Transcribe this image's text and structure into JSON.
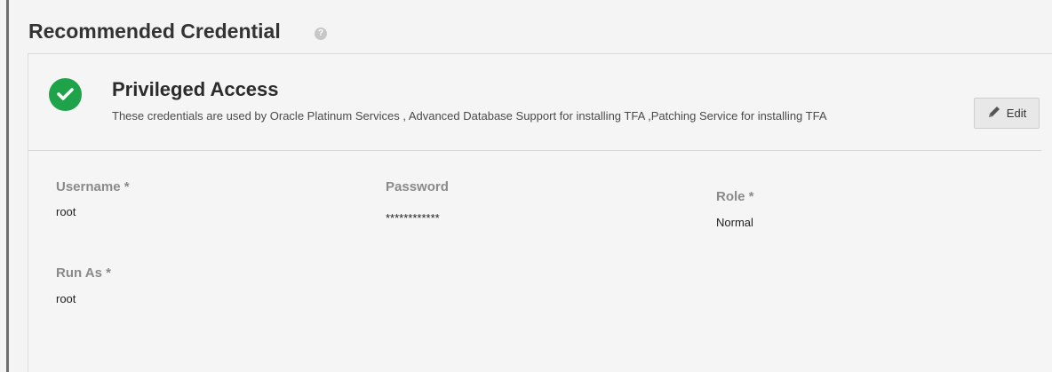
{
  "header": {
    "title": "Recommended Credential",
    "help_icon": "help-icon"
  },
  "credential": {
    "status_icon": "check-circle-icon",
    "status_color": "#1fa34a",
    "title": "Privileged Access",
    "description": "These credentials are used by Oracle Platinum Services , Advanced Database Support for installing TFA ,Patching Service for installing TFA",
    "edit_label": "Edit",
    "edit_icon": "pencil-icon"
  },
  "fields": {
    "username": {
      "label": "Username *",
      "value": "root"
    },
    "password": {
      "label": "Password",
      "value": "************"
    },
    "role": {
      "label": "Role *",
      "value": "Normal"
    },
    "run_as": {
      "label": "Run As *",
      "value": "root"
    }
  }
}
